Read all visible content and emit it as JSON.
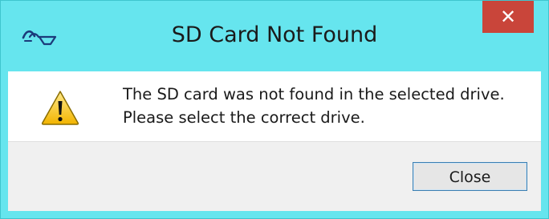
{
  "window": {
    "title": "SD Card Not Found",
    "close_glyph": "✕",
    "titlebar_color": "#66e5ee",
    "close_color": "#c9453a"
  },
  "message": {
    "line1": "The SD card was not found in the selected drive.",
    "line2": "Please select the correct drive.",
    "icon": "warning-icon"
  },
  "buttons": {
    "close_label": "Close"
  },
  "icons": {
    "app": "app-logo-icon",
    "titlebar_close": "close-icon"
  }
}
